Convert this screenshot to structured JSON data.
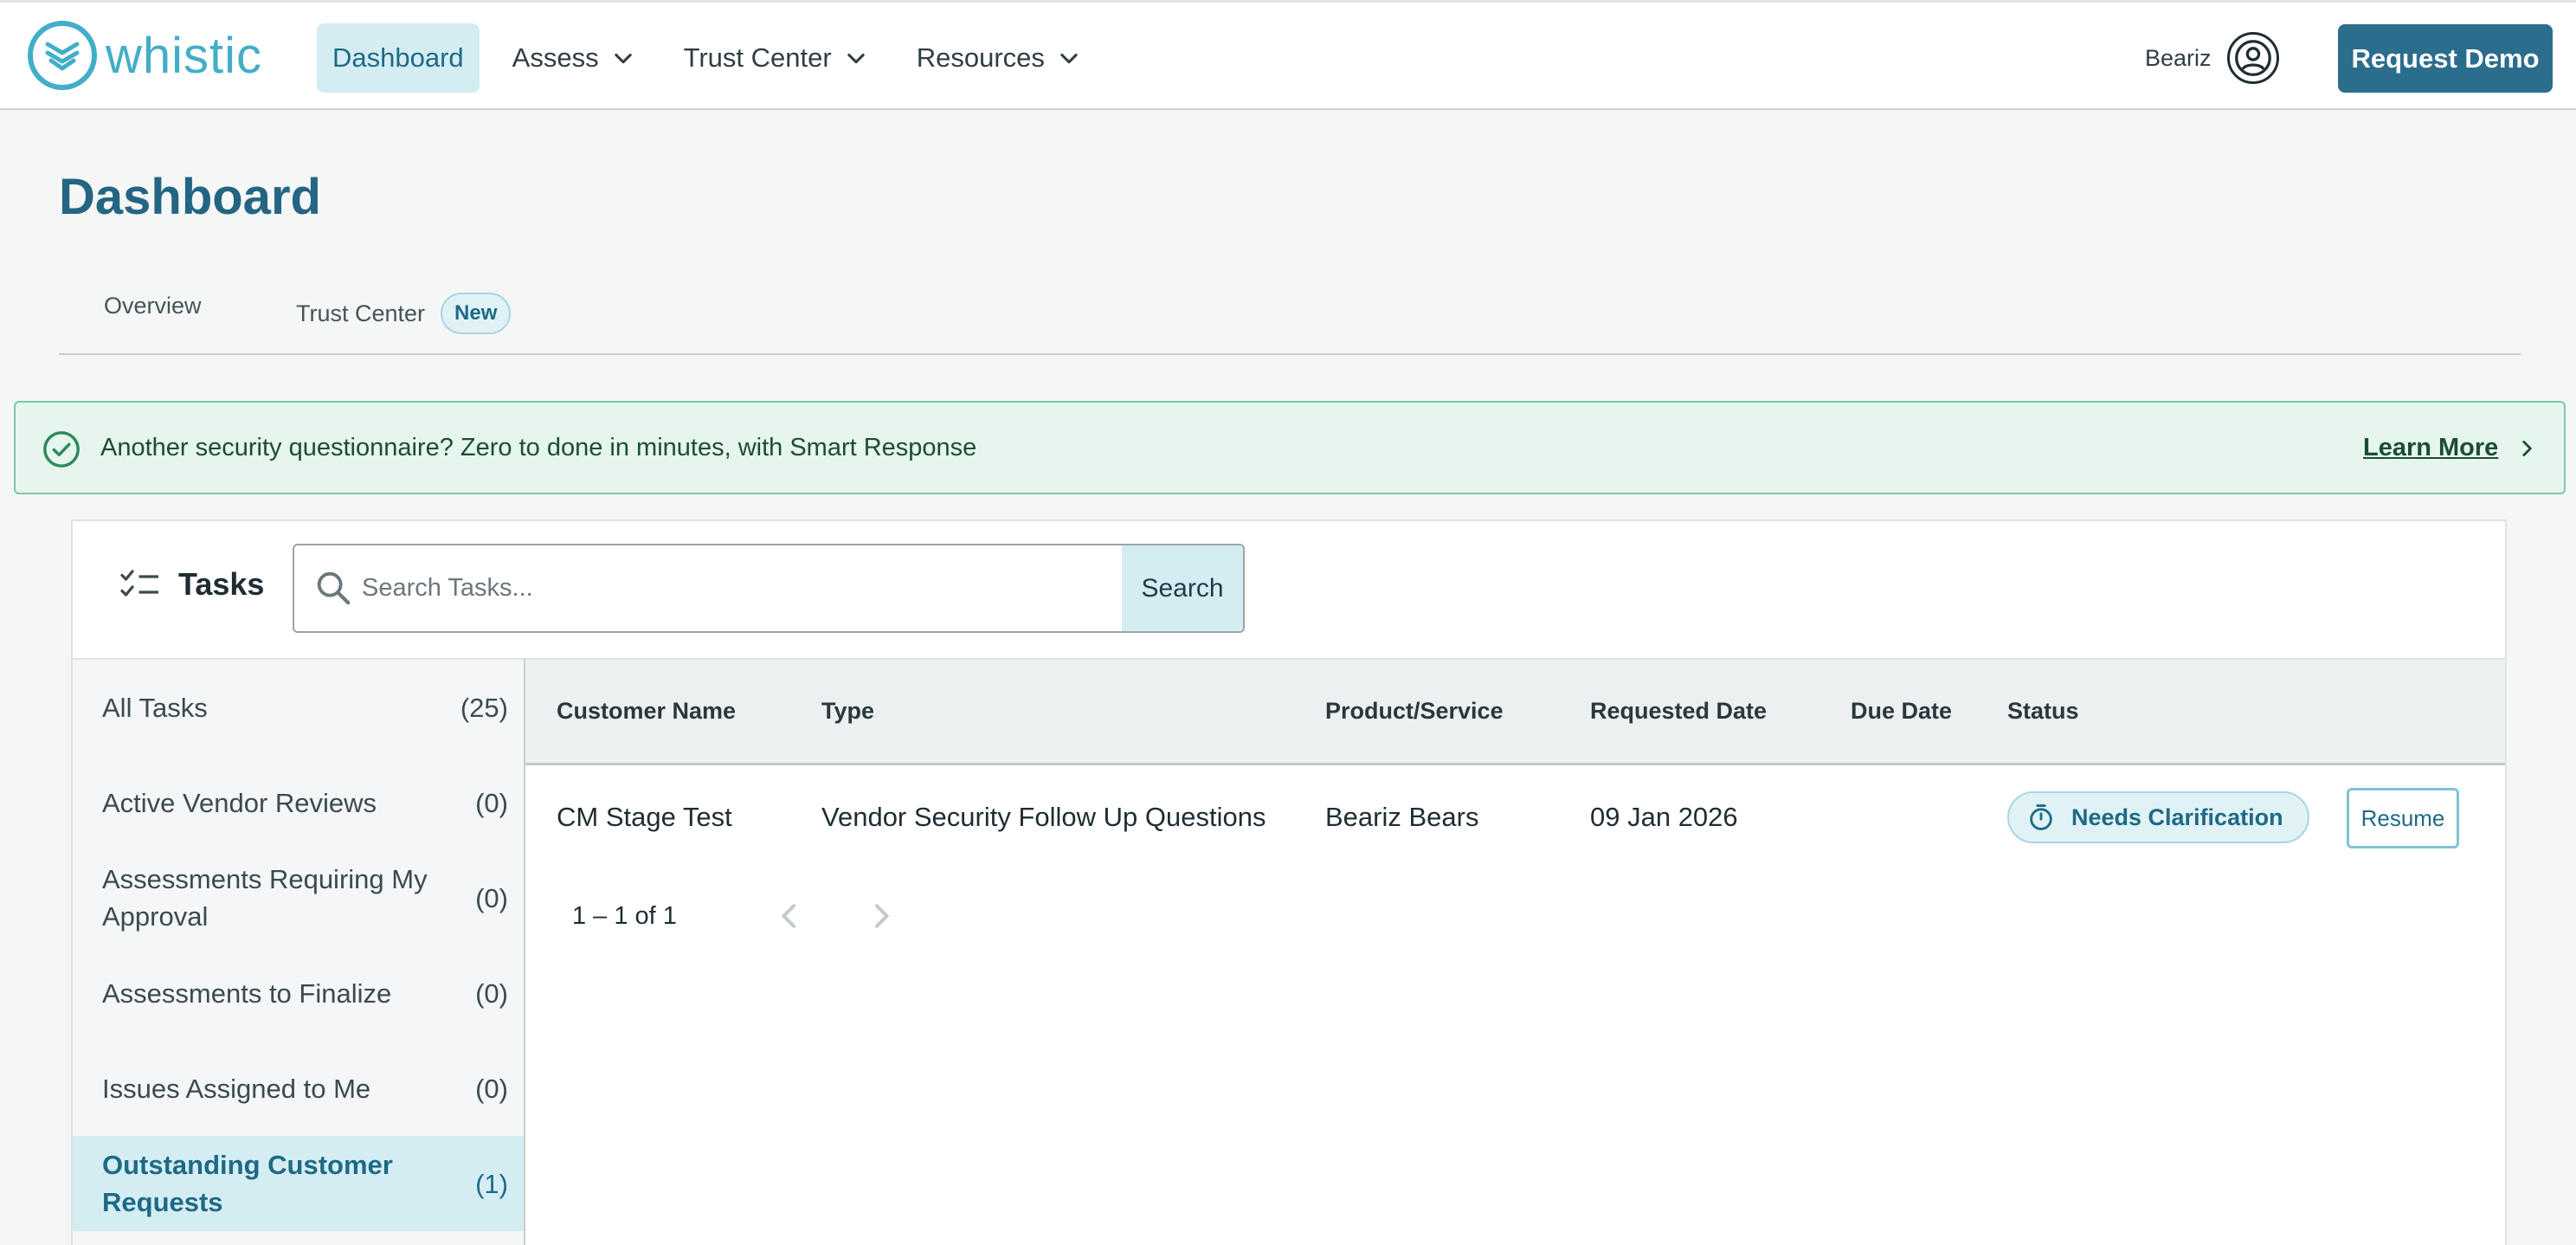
{
  "brand": {
    "name": "whistic",
    "color": "#42aec8"
  },
  "nav": {
    "items": [
      {
        "label": "Dashboard",
        "active": true,
        "has_dropdown": false
      },
      {
        "label": "Assess",
        "active": false,
        "has_dropdown": true
      },
      {
        "label": "Trust Center",
        "active": false,
        "has_dropdown": true
      },
      {
        "label": "Resources",
        "active": false,
        "has_dropdown": true
      }
    ],
    "user_name": "Beariz",
    "demo_button": "Request Demo"
  },
  "page": {
    "title": "Dashboard",
    "tabs": [
      {
        "label": "Overview"
      },
      {
        "label": "Trust Center",
        "badge": "New"
      }
    ]
  },
  "banner": {
    "text": "Another security questionnaire? Zero to done in minutes, with Smart Response",
    "link": "Learn More"
  },
  "tasks": {
    "title": "Tasks",
    "search_placeholder": "Search Tasks...",
    "search_button": "Search",
    "categories": [
      {
        "label": "All Tasks",
        "count": "(25)"
      },
      {
        "label": "Active Vendor Reviews",
        "count": "(0)"
      },
      {
        "label": "Assessments Requiring My Approval",
        "count": "(0)"
      },
      {
        "label": "Assessments to Finalize",
        "count": "(0)"
      },
      {
        "label": "Issues Assigned to Me",
        "count": "(0)"
      },
      {
        "label": "Outstanding Customer Requests",
        "count": "(1)",
        "active": true
      }
    ],
    "columns": [
      "Customer Name",
      "Type",
      "Product/Service",
      "Requested Date",
      "Due Date",
      "Status"
    ],
    "rows": [
      {
        "customer": "CM Stage Test",
        "type": "Vendor Security Follow Up Questions",
        "product": "Beariz Bears",
        "requested": "09 Jan 2026",
        "due": "",
        "status": "Needs Clarification",
        "action": "Resume"
      }
    ],
    "pagination": "1 – 1 of 1"
  },
  "colors": {
    "primary": "#2b6d8d",
    "title": "#246583",
    "active_bg": "#d4edf3",
    "banner_bg": "#e6f5ee",
    "banner_border": "#80c8a2",
    "banner_text": "#1c4d33"
  }
}
